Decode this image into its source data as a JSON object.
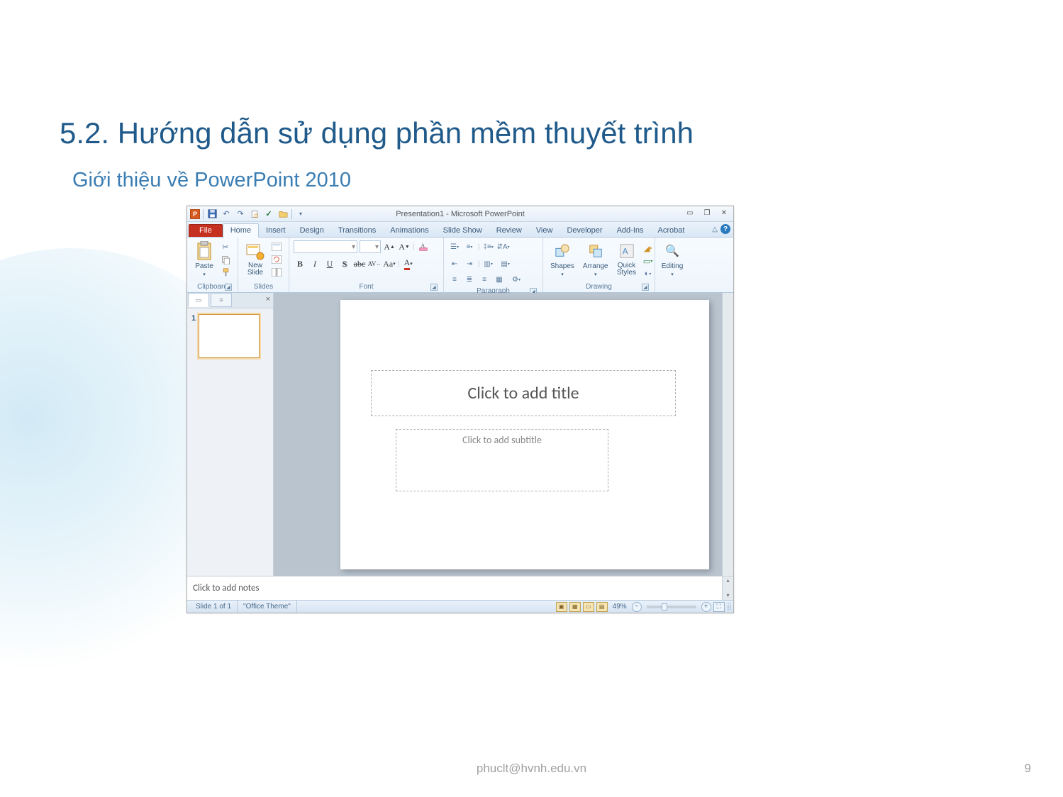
{
  "slide": {
    "title": "5.2. Hướng dẫn sử dụng phần mềm thuyết trình",
    "subtitle": "Giới thiệu về PowerPoint 2010",
    "footer_email": "phuclt@hvnh.edu.vn",
    "page_number": "9"
  },
  "app": {
    "qat_app_letter": "P",
    "window_title": "Presentation1 - Microsoft PowerPoint",
    "tabs": {
      "file": "File",
      "home": "Home",
      "insert": "Insert",
      "design": "Design",
      "transitions": "Transitions",
      "animations": "Animations",
      "slideshow": "Slide Show",
      "review": "Review",
      "view": "View",
      "developer": "Developer",
      "addins": "Add-Ins",
      "acrobat": "Acrobat"
    },
    "ribbon": {
      "clipboard": {
        "label": "Clipboard",
        "paste": "Paste"
      },
      "slides": {
        "label": "Slides",
        "new_slide": "New\nSlide"
      },
      "font": {
        "label": "Font",
        "bold": "B",
        "italic": "I",
        "underline": "U",
        "strike": "S",
        "shadow_abc": "abc",
        "spacing": "AV",
        "case": "Aa",
        "colorA": "A",
        "grow": "A",
        "shrink": "A",
        "clear": "Aa"
      },
      "paragraph": {
        "label": "Paragraph"
      },
      "drawing": {
        "label": "Drawing",
        "shapes": "Shapes",
        "arrange": "Arrange",
        "quick_styles": "Quick\nStyles"
      },
      "editing": {
        "label": "Editing"
      }
    },
    "slide_pane": {
      "thumb_number": "1"
    },
    "canvas": {
      "title_placeholder": "Click to add title",
      "subtitle_placeholder": "Click to add subtitle"
    },
    "notes": {
      "placeholder": "Click to add notes"
    },
    "status": {
      "slide_of": "Slide 1 of 1",
      "theme": "\"Office Theme\"",
      "zoom_pct": "49%"
    }
  }
}
